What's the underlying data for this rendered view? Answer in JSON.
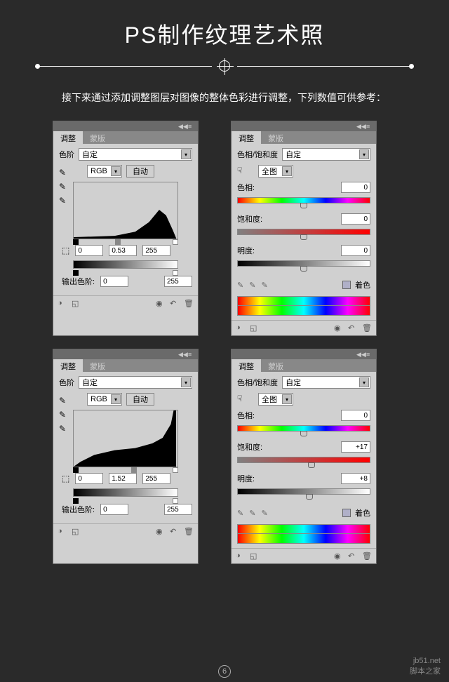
{
  "title": "PS制作纹理艺术照",
  "intro": "接下来通过添加调整图层对图像的整体色彩进行调整，下列数值可供参考：",
  "tabs": {
    "adjust": "调整",
    "mask": "蒙版"
  },
  "levels": {
    "label": "色阶",
    "preset": "自定",
    "channel": "RGB",
    "auto": "自动",
    "outputLabel": "输出色阶:",
    "panel1": {
      "black": "0",
      "gamma": "0.53",
      "white": "255",
      "outBlack": "0",
      "outWhite": "255"
    },
    "panel3": {
      "black": "0",
      "gamma": "1.52",
      "white": "255",
      "outBlack": "0",
      "outWhite": "255"
    }
  },
  "hsl": {
    "label": "色相/饱和度",
    "preset": "自定",
    "range": "全图",
    "hueLabel": "色相:",
    "satLabel": "饱和度:",
    "lightLabel": "明度:",
    "colorize": "着色",
    "panel2": {
      "hue": "0",
      "sat": "0",
      "light": "0"
    },
    "panel4": {
      "hue": "0",
      "sat": "+17",
      "light": "+8"
    }
  },
  "pageNum": "6",
  "watermark": {
    "line1": "jb51.net",
    "line2": "脚本之家"
  }
}
